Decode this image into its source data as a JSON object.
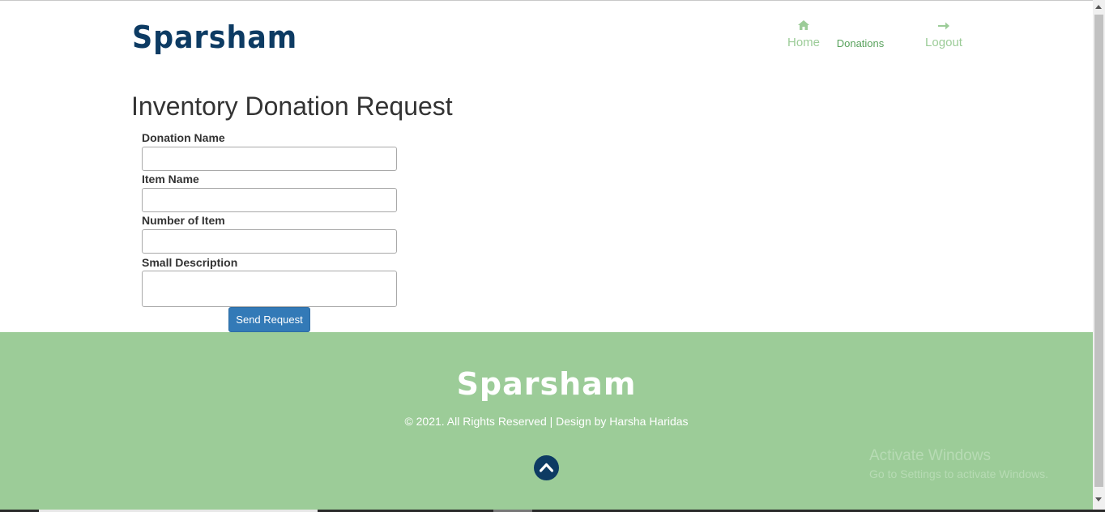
{
  "header": {
    "logo": "Sparsham",
    "nav": {
      "home_label": "Home",
      "home_icon": "home-icon",
      "donations_label": "Donations",
      "logout_label": "Logout",
      "logout_icon": "arrow-right-icon"
    }
  },
  "main": {
    "title": "Inventory Donation Request",
    "form": {
      "fields": [
        {
          "label": "Donation Name",
          "value": ""
        },
        {
          "label": "Item Name",
          "value": ""
        },
        {
          "label": "Number of Item",
          "value": ""
        },
        {
          "label": "Small Description",
          "value": ""
        }
      ],
      "submit_label": "Send Request"
    }
  },
  "footer": {
    "logo": "Sparsham",
    "copyright": "© 2021. All Rights Reserved | Design by Harsha Haridas",
    "scroll_top_icon": "chevron-up-icon"
  },
  "watermark": {
    "line1": "Activate Windows",
    "line2": "Go to Settings to activate Windows."
  },
  "colors": {
    "brand": "#0d3b63",
    "accent_green": "#9ccc98",
    "button": "#337ab7"
  }
}
